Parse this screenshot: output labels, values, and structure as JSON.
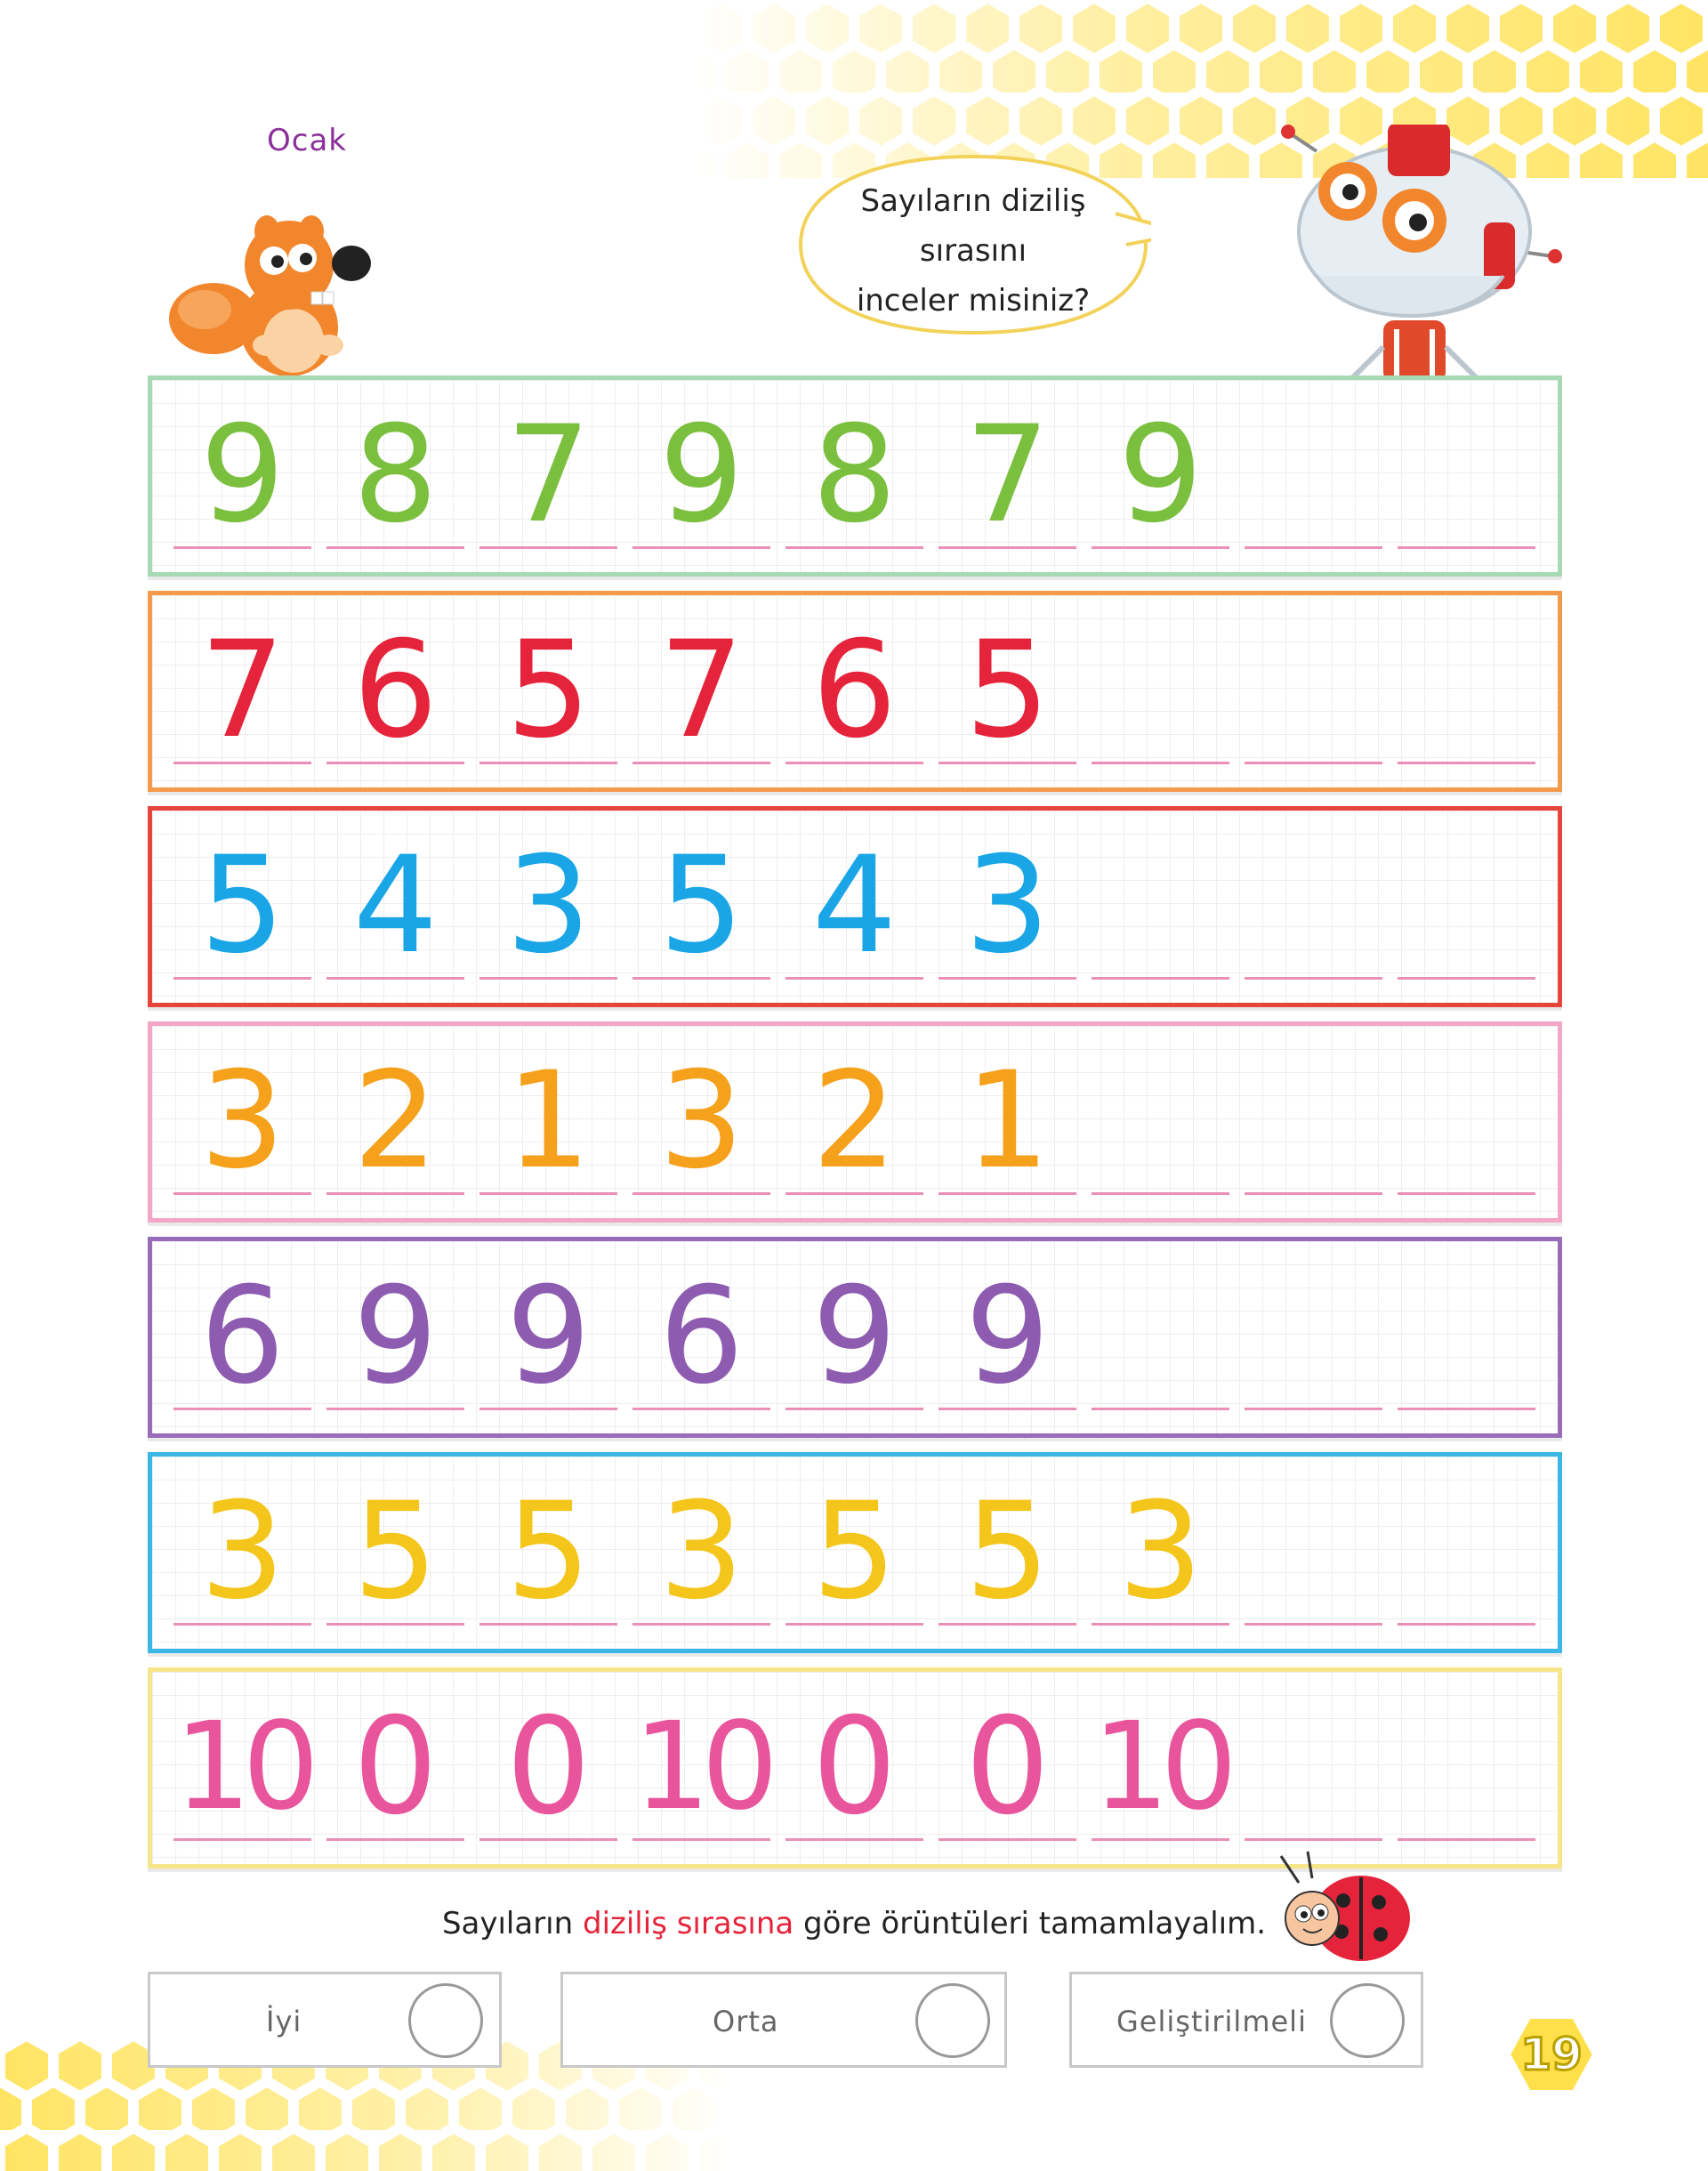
{
  "header": {
    "month": "Ocak",
    "speech_bubble": [
      "Sayıların diziliş",
      "sırasını",
      "inceler misiniz?"
    ]
  },
  "rows": [
    {
      "border": "#a8d9b5",
      "color": "#7bbf3f",
      "numbers": [
        "9",
        "8",
        "7",
        "9",
        "8",
        "7",
        "9",
        "",
        ""
      ]
    },
    {
      "border": "#f39a4b",
      "color": "#e5243b",
      "numbers": [
        "7",
        "6",
        "5",
        "7",
        "6",
        "5",
        "",
        "",
        ""
      ]
    },
    {
      "border": "#e5453b",
      "color": "#1aa6e6",
      "numbers": [
        "5",
        "4",
        "3",
        "5",
        "4",
        "3",
        "",
        "",
        ""
      ]
    },
    {
      "border": "#f3a6c6",
      "color": "#f5a11c",
      "numbers": [
        "3",
        "2",
        "1",
        "3",
        "2",
        "1",
        "",
        "",
        ""
      ]
    },
    {
      "border": "#9a6bb8",
      "color": "#8d5cb0",
      "numbers": [
        "6",
        "9",
        "9",
        "6",
        "9",
        "9",
        "",
        "",
        ""
      ]
    },
    {
      "border": "#3bb7e6",
      "color": "#f4c51a",
      "numbers": [
        "3",
        "5",
        "5",
        "3",
        "5",
        "5",
        "3",
        "",
        ""
      ]
    },
    {
      "border": "#f7e58a",
      "color": "#e9559c",
      "numbers": [
        "10",
        "0",
        "0",
        "10",
        "0",
        "0",
        "10",
        "",
        ""
      ]
    }
  ],
  "instruction": {
    "before": "Sayıların ",
    "highlight": "diziliş sırasına",
    "after": " göre örüntüleri tamamlayalım."
  },
  "evaluation": {
    "options": [
      "İyi",
      "Orta",
      "Geliştirilmeli"
    ]
  },
  "page_number": "19",
  "colors": {
    "honeycomb": "#ffe04a",
    "tracing_line": "#e98fb8",
    "highlight_text": "#e5243b"
  }
}
